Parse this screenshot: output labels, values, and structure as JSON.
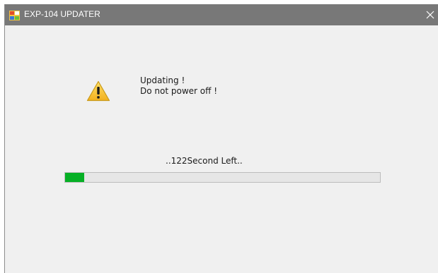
{
  "window": {
    "title": "EXP-104 UPDATER",
    "icons": {
      "app": "app-icon",
      "close": "close-icon",
      "warning": "warning-icon"
    }
  },
  "message": {
    "line1": "Updating !",
    "line2": "Do not power off !"
  },
  "status": {
    "time_left": "..122Second Left.."
  },
  "progress": {
    "percent": 6,
    "color": "#06b025"
  },
  "colors": {
    "titlebar": "#787878",
    "background": "#f0f0f0"
  }
}
